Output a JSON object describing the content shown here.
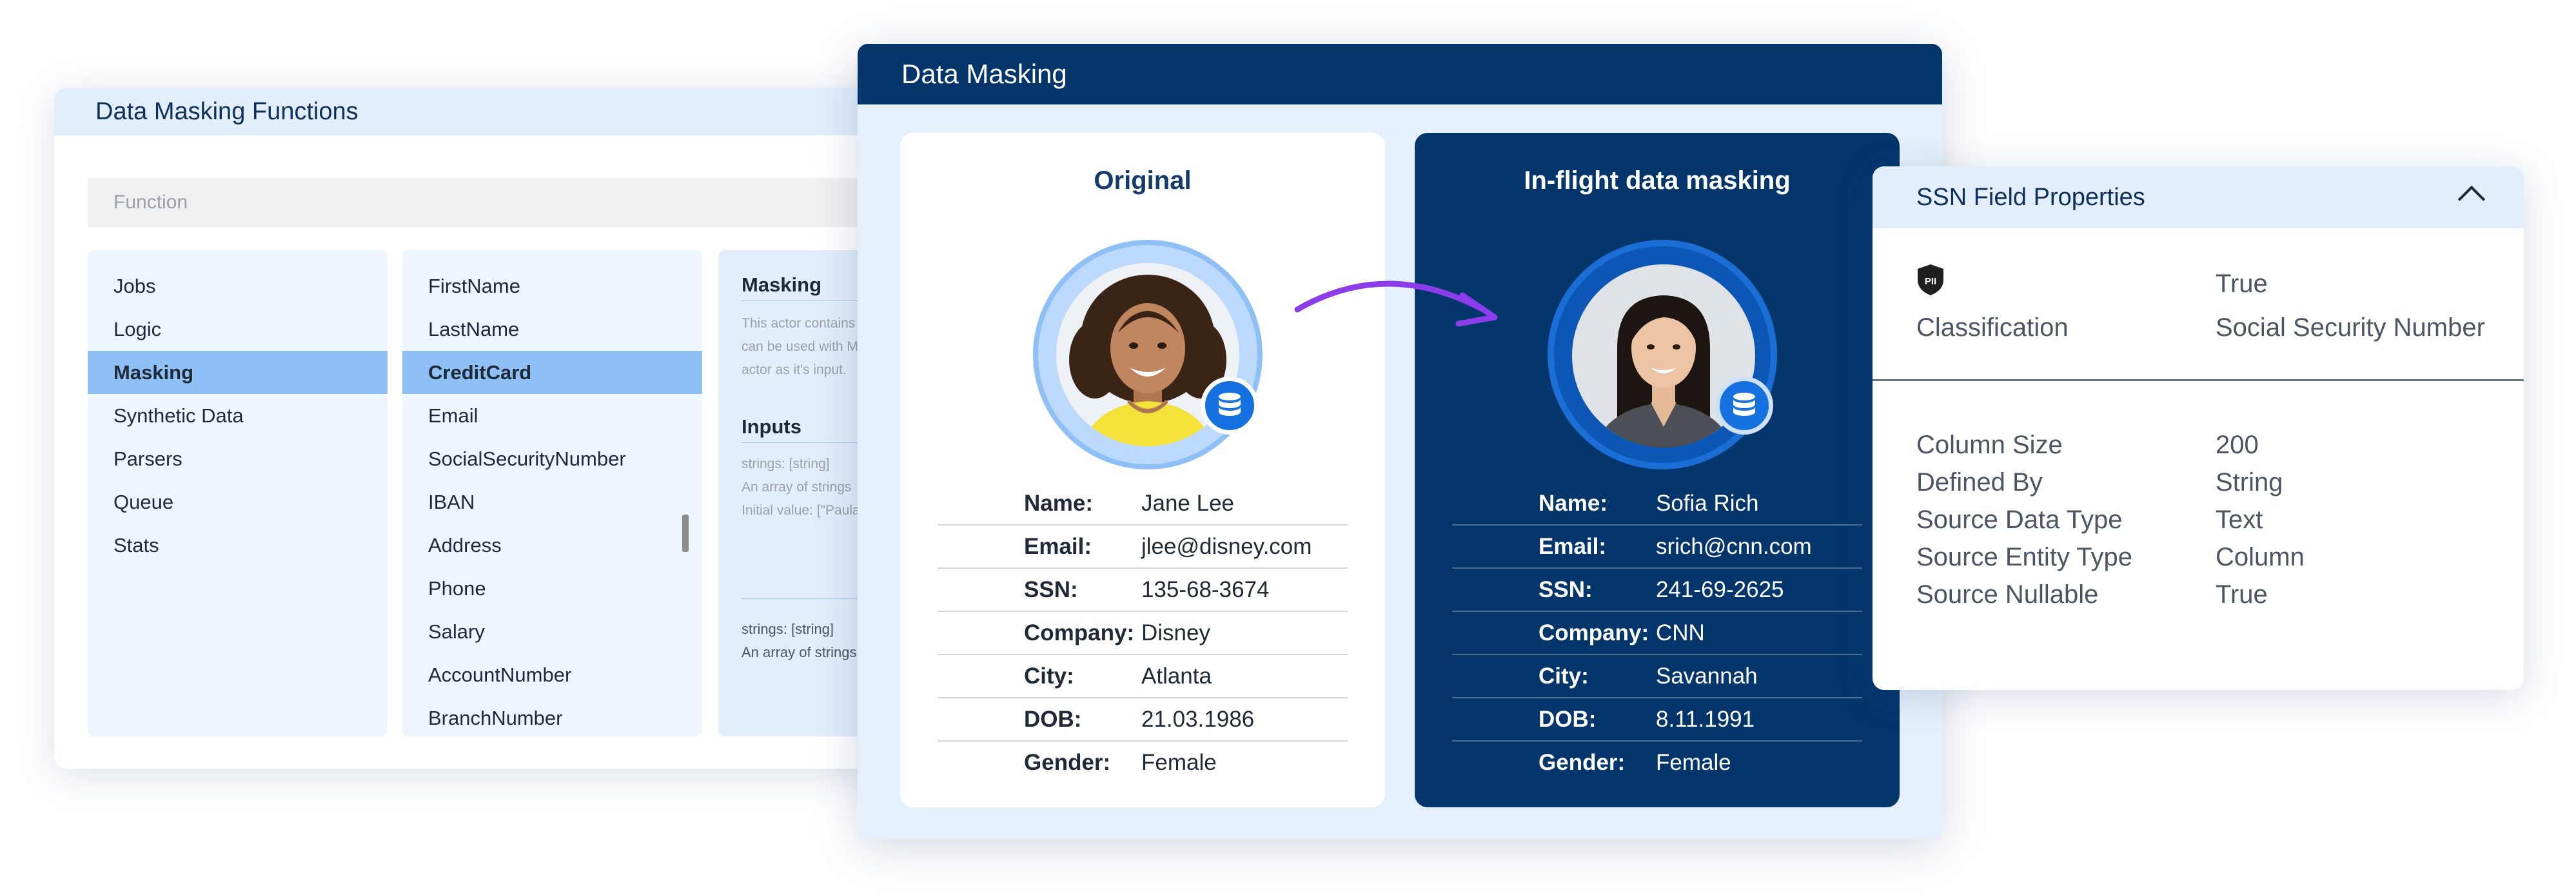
{
  "functions_panel": {
    "title": "Data Masking Functions",
    "search_placeholder": "Function",
    "categories": [
      "Jobs",
      "Logic",
      "Masking",
      "Synthetic Data",
      "Parsers",
      "Queue",
      "Stats"
    ],
    "selected_category": "Masking",
    "functions": [
      "FirstName",
      "LastName",
      "CreditCard",
      "Email",
      "SocialSecurityNumber",
      "IBAN",
      "Address",
      "Phone",
      "Salary",
      "AccountNumber",
      "BranchNumber"
    ],
    "selected_function": "CreditCard",
    "detail": {
      "heading": "Masking",
      "description_lines": [
        "This actor contains",
        "can be used with M",
        "actor as it's input."
      ],
      "inputs_heading": "Inputs",
      "input1_lines": [
        "strings: [string]",
        "An array of strings",
        "Initial value: [\"Paula"
      ],
      "input2_lines": [
        "strings: [string]",
        "An array of strings"
      ]
    }
  },
  "masking_panel": {
    "title": "Data Masking",
    "original": {
      "title": "Original",
      "fields": [
        {
          "label": "Name:",
          "value": "Jane Lee"
        },
        {
          "label": "Email:",
          "value": "jlee@disney.com"
        },
        {
          "label": "SSN:",
          "value": "135-68-3674"
        },
        {
          "label": "Company:",
          "value": "Disney"
        },
        {
          "label": "City:",
          "value": "Atlanta"
        },
        {
          "label": "DOB:",
          "value": "21.03.1986"
        },
        {
          "label": "Gender:",
          "value": "Female"
        }
      ]
    },
    "masked": {
      "title": "In-flight data masking",
      "fields": [
        {
          "label": "Name:",
          "value": "Sofia Rich"
        },
        {
          "label": "Email:",
          "value": "srich@cnn.com"
        },
        {
          "label": "SSN:",
          "value": "241-69-2625"
        },
        {
          "label": "Company:",
          "value": "CNN"
        },
        {
          "label": "City:",
          "value": "Savannah"
        },
        {
          "label": "DOB:",
          "value": "8.11.1991"
        },
        {
          "label": "Gender:",
          "value": "Female"
        }
      ]
    },
    "arrow_color": "#8b3dea",
    "icons": [
      "person-avatar-icon",
      "database-icon",
      "curved-arrow-icon"
    ]
  },
  "ssn_panel": {
    "title": "SSN Field Properties",
    "pii_icon_label": "PII",
    "classification": {
      "label": "Classification",
      "flag": "True",
      "value": "Social Security Number"
    },
    "properties": [
      {
        "label": "Column Size",
        "value": "200"
      },
      {
        "label": "Defined By",
        "value": "String"
      },
      {
        "label": "Source Data Type",
        "value": "Text"
      },
      {
        "label": "Source Entity Type",
        "value": "Column"
      },
      {
        "label": "Source Nullable",
        "value": "True"
      }
    ]
  },
  "colors": {
    "navy": "#04366b",
    "light_blue": "#e3eefc",
    "selection": "#8ec0f5",
    "accent_blue": "#1571e0"
  }
}
